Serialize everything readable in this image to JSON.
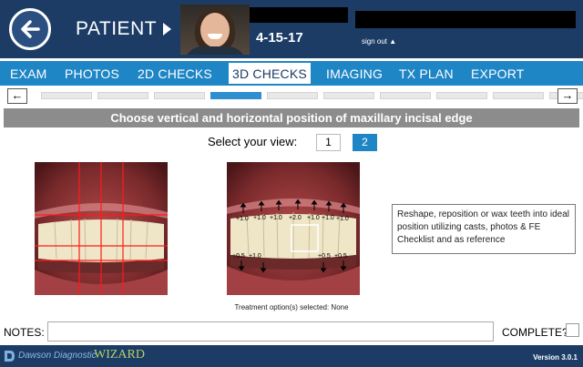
{
  "header": {
    "patient_label": "PATIENT",
    "date": "4-15-17",
    "sign_out": "sign out ▲"
  },
  "nav": {
    "items": [
      {
        "label": "EXAM"
      },
      {
        "label": "PHOTOS"
      },
      {
        "label": "2D CHECKS"
      },
      {
        "label": "3D CHECKS",
        "active": true
      },
      {
        "label": "IMAGING"
      },
      {
        "label": "TX PLAN"
      },
      {
        "label": "EXPORT"
      }
    ]
  },
  "progress": {
    "prev": "←",
    "next": "→",
    "total_steps": 10,
    "active_step": 4
  },
  "instruction": "Choose vertical and horizontal position of maxillary incisal edge",
  "view_selector": {
    "label": "Select your view:",
    "options": [
      "1",
      "2"
    ],
    "selected": "2"
  },
  "view2_labels": {
    "upper": [
      "+1.0",
      "+1.0",
      "+1.0",
      "+2.0",
      "+1.0",
      "+1.0",
      "+1.0"
    ],
    "lower_left": "+0.5",
    "lower_left_b": "+1.0",
    "lower_right": "+0.5",
    "lower_right_b": "+0.5"
  },
  "info_box": "Reshape, reposition or wax teeth into ideal position utilizing casts, photos & FE Checklist and as reference",
  "treatment": "Treatment option(s) selected: None",
  "notes": {
    "label": "NOTES:",
    "value": "",
    "placeholder": ""
  },
  "complete_label": "COMPLETE?",
  "footer": {
    "brand": "Dawson Diagnostic",
    "brand_wizard": "WIZARD",
    "version": "Version 3.0.1"
  },
  "colors": {
    "header_bg": "#1c3c66",
    "nav_bg": "#1f86c6",
    "accent": "#2f8ed0",
    "instruction_bg": "#8c8c8c"
  }
}
